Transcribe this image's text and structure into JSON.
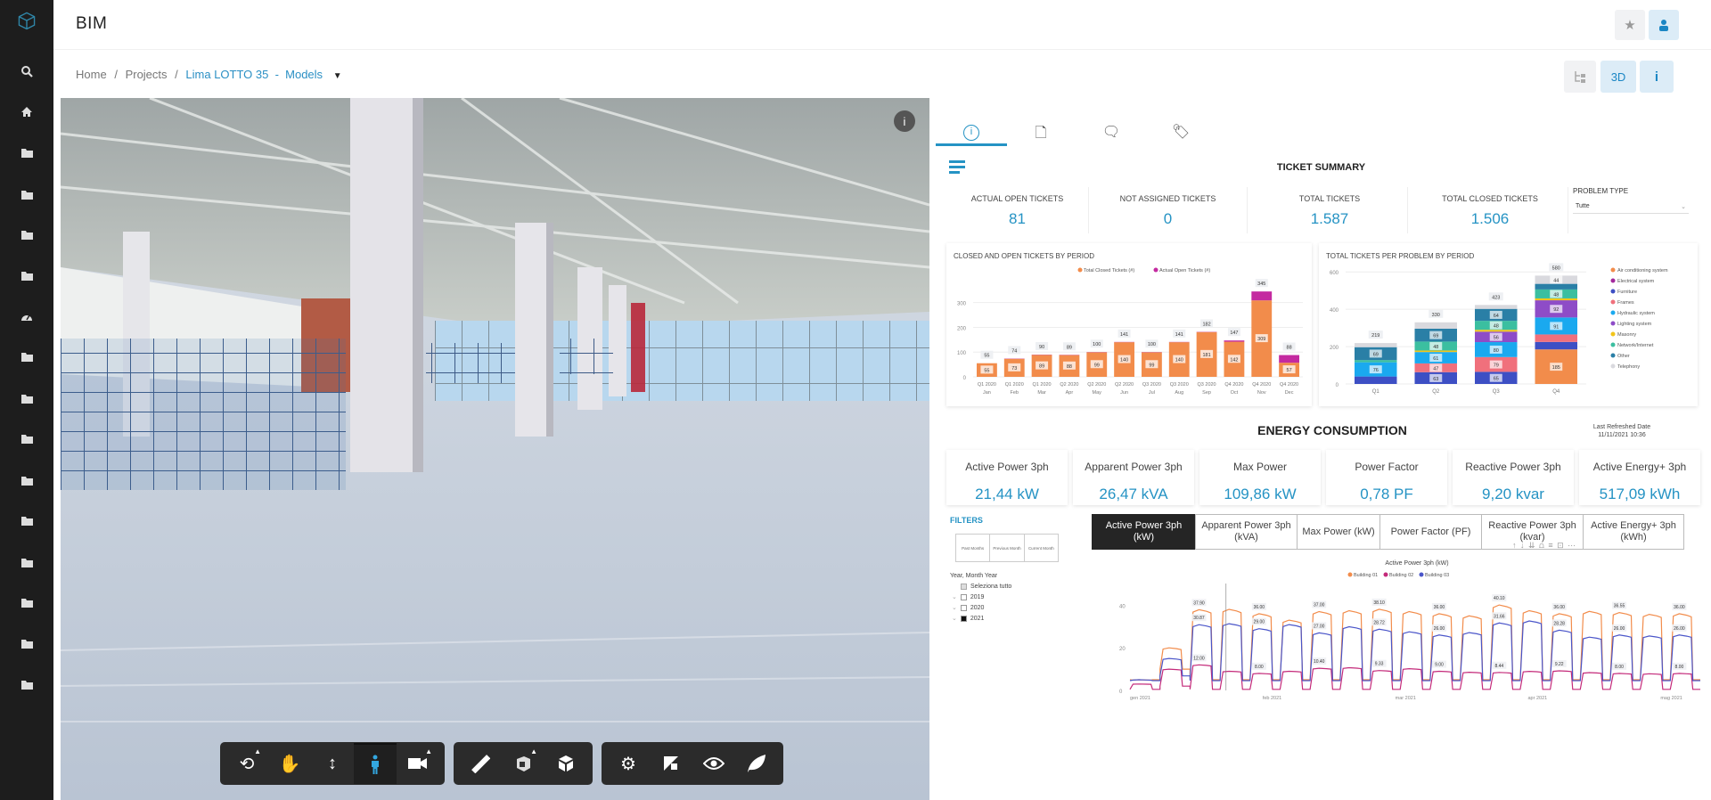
{
  "app": {
    "title": "BIM"
  },
  "header": {
    "star_icon": "star-icon",
    "user_icon": "user-icon"
  },
  "breadcrumb": {
    "home": "Home",
    "sep": "/",
    "projects": "Projects",
    "current": "Lima LOTTO 35  -  Models"
  },
  "view_buttons": {
    "tree_icon": "tree-icon",
    "three_d": "3D",
    "info": "i"
  },
  "sidebar": {
    "items": [
      "logo",
      "search",
      "home",
      "folder",
      "folder",
      "folder",
      "folder",
      "dashboard",
      "folder",
      "folder",
      "folder",
      "folder",
      "folder",
      "folder",
      "folder",
      "folder",
      "folder"
    ]
  },
  "viewer": {
    "info": "i",
    "toolbar": [
      [
        "orbit",
        "pan",
        "zoom",
        "first-person",
        "camera"
      ],
      [
        "measure",
        "section",
        "explode"
      ],
      [
        "settings",
        "model-browser",
        "properties",
        "environment"
      ]
    ]
  },
  "panel": {
    "tabs": [
      "info",
      "document",
      "comments",
      "tags"
    ],
    "ticket_summary": {
      "title": "TICKET SUMMARY",
      "kpis": [
        {
          "label": "ACTUAL OPEN TICKETS",
          "value": "81"
        },
        {
          "label": "NOT ASSIGNED TICKETS",
          "value": "0"
        },
        {
          "label": "TOTAL TICKETS",
          "value": "1.587"
        },
        {
          "label": "TOTAL CLOSED TICKETS",
          "value": "1.506"
        }
      ],
      "problem_type": {
        "label": "PROBLEM TYPE",
        "value": "Tutte"
      }
    },
    "energy": {
      "title": "ENERGY CONSUMPTION",
      "refreshed_label": "Last Refreshed Date",
      "refreshed_value": "11/11/2021 10:36",
      "kpis": [
        {
          "label": "Active Power 3ph",
          "value": "21,44 kW"
        },
        {
          "label": "Apparent Power 3ph",
          "value": "26,47 kVA"
        },
        {
          "label": "Max Power",
          "value": "109,86 kW"
        },
        {
          "label": "Power Factor",
          "value": "0,78 PF"
        },
        {
          "label": "Reactive Power 3ph",
          "value": "9,20 kvar"
        },
        {
          "label": "Active Energy+ 3ph",
          "value": "517,09 kWh"
        }
      ],
      "metric_tabs": [
        "Active Power 3ph (kW)",
        "Apparent Power 3ph (kVA)",
        "Max Power (kW)",
        "Power Factor (PF)",
        "Reactive Power 3ph (kvar)",
        "Active Energy+ 3ph (kWh)"
      ],
      "filters": {
        "title": "FILTERS",
        "period_buttons": [
          "Past Months",
          "Previous Month",
          "Current Month"
        ],
        "tree_label": "Year, Month Year",
        "select_all": "Seleziona tutto",
        "years": [
          {
            "label": "2019",
            "checked": false
          },
          {
            "label": "2020",
            "checked": false
          },
          {
            "label": "2021",
            "checked": true
          }
        ]
      }
    }
  },
  "chart_data": [
    {
      "type": "bar",
      "title": "CLOSED AND OPEN TICKETS  BY PERIOD",
      "categories": [
        "Q1 2020|Jan",
        "Q1 2020|Feb",
        "Q1 2020|Mar",
        "Q2 2020|Apr",
        "Q2 2020|May",
        "Q2 2020|Jun",
        "Q3 2020|Jul",
        "Q3 2020|Aug",
        "Q3 2020|Sep",
        "Q4 2020|Oct",
        "Q4 2020|Nov",
        "Q4 2020|Dec"
      ],
      "series": [
        {
          "name": "Total Closed Tickets (#)",
          "color": "#f28c4b",
          "values": [
            55,
            73,
            89,
            88,
            99,
            140,
            99,
            140,
            181,
            142,
            309,
            57
          ]
        },
        {
          "name": "Actual Open Tickets (#)",
          "color": "#c42aa0",
          "values": [
            0,
            1,
            1,
            1,
            1,
            1,
            1,
            1,
            1,
            5,
            36,
            31
          ]
        }
      ],
      "totals": [
        55,
        74,
        90,
        89,
        100,
        141,
        100,
        141,
        182,
        147,
        345,
        88
      ],
      "yticks": [
        0,
        100,
        200,
        300
      ],
      "ylim": [
        0,
        360
      ],
      "legend": "top-center"
    },
    {
      "type": "bar",
      "stacked": true,
      "title": "TOTAL TICKETS PER PROBLEM BY PERIOD",
      "categories": [
        "Q1",
        "Q2",
        "Q3",
        "Q4"
      ],
      "series": [
        {
          "name": "Air conditioning system",
          "color": "#f28c4b",
          "values": [
            0,
            0,
            0,
            185
          ]
        },
        {
          "name": "Electrical system",
          "color": "#a3299c",
          "values": [
            0,
            0,
            0,
            0
          ]
        },
        {
          "name": "Furniture",
          "color": "#3d4fc4",
          "values": [
            40,
            63,
            65,
            40
          ]
        },
        {
          "name": "Frames",
          "color": "#f0707c",
          "values": [
            0,
            47,
            79,
            40
          ]
        },
        {
          "name": "Hydraulic system",
          "color": "#1aa9ef",
          "values": [
            76,
            61,
            80,
            91
          ]
        },
        {
          "name": "Lighting system",
          "color": "#8e4cc7",
          "values": [
            0,
            0,
            56,
            92
          ]
        },
        {
          "name": "Masonry",
          "color": "#f2c51a",
          "values": [
            0,
            8,
            10,
            10
          ]
        },
        {
          "name": "Network/Internet",
          "color": "#3bbfa0",
          "values": [
            12,
            48,
            48,
            48
          ]
        },
        {
          "name": "Other",
          "color": "#2a7fa6",
          "values": [
            69,
            69,
            64,
            30
          ]
        },
        {
          "name": "Telephony",
          "color": "#d9d9de",
          "values": [
            22,
            34,
            21,
            44
          ]
        }
      ],
      "totals": [
        219,
        330,
        423,
        580
      ],
      "yticks": [
        0,
        200,
        400,
        600
      ],
      "ylim": [
        0,
        620
      ],
      "legend": "right"
    },
    {
      "type": "line",
      "title": "Active Power 3ph (kW)",
      "x_labels": [
        "gen 2021",
        "feb 2021",
        "mar 2021",
        "apr 2021",
        "mag 2021"
      ],
      "x_unit": "week",
      "yticks": [
        0,
        20,
        40
      ],
      "ylim": [
        0,
        46
      ],
      "series": [
        {
          "name": "Building 01",
          "color": "#f28c4b",
          "weekday": [
            5,
            20,
            37.9,
            38.05,
            36,
            33,
            37,
            37.41,
            38.1,
            37,
            36,
            35,
            40.1,
            37.44,
            36,
            37.08,
            36.55,
            35.7,
            36
          ],
          "weekend": [
            5,
            10,
            5,
            5,
            5,
            5,
            5,
            5,
            5,
            5,
            5,
            5,
            5,
            5,
            5,
            5,
            5,
            5,
            5
          ]
        },
        {
          "name": "Building 02",
          "color": "#c42a7a",
          "weekday": [
            3,
            10,
            12,
            9,
            8,
            9,
            10.4,
            10.67,
            9.33,
            10.21,
            9,
            8.54,
            8.44,
            8.95,
            9.22,
            8.35,
            8,
            7.8,
            8
          ],
          "weekend": [
            0.5,
            2,
            0.5,
            0.5,
            0.5,
            0.5,
            0.5,
            0.5,
            0.5,
            0.5,
            0.5,
            0.5,
            0.5,
            0.5,
            0.5,
            0.5,
            0.5,
            0.5,
            0.5
          ]
        },
        {
          "name": "Building 03",
          "color": "#4a55c9",
          "weekday": [
            5,
            15,
            30.87,
            31.33,
            29,
            30.92,
            27,
            29.9,
            28.72,
            27.52,
            26,
            27.13,
            31.66,
            32.63,
            28.28,
            25,
            26,
            25.56,
            26
          ],
          "weekend": [
            4.6,
            6.8,
            4.6,
            4.6,
            4.6,
            4.6,
            4.6,
            4.6,
            4.6,
            4.6,
            4.6,
            4.6,
            4.6,
            4.6,
            4.6,
            4.6,
            4.6,
            4.6,
            4.6
          ]
        }
      ],
      "legend": "top-center"
    }
  ]
}
